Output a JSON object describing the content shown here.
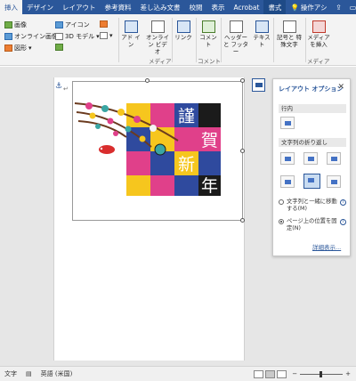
{
  "tabs": [
    {
      "label": "挿入",
      "active": true
    },
    {
      "label": "デザイン"
    },
    {
      "label": "レイアウト"
    },
    {
      "label": "参考資料"
    },
    {
      "label": "差し込み文書"
    },
    {
      "label": "校閲"
    },
    {
      "label": "表示"
    },
    {
      "label": "Acrobat"
    },
    {
      "label": "書式",
      "accent": true
    }
  ],
  "search": {
    "label": "操作アシ"
  },
  "ribbon": {
    "image": "画像",
    "online_image": "オンライン画像",
    "shapes": "図形",
    "icons": "アイコン",
    "model3d": "3D モデル",
    "addins": "アド イン",
    "online_video": "オンライン ビデオ",
    "link": "リンク",
    "comment": "コメント",
    "header_footer": "ヘッダーと フッター",
    "text": "テキスト",
    "symbols": "記号と 特殊文字",
    "media_insert": "メディア を挿入",
    "group_media": "メディア",
    "group_comment": "コメント",
    "group_media2": "メディア"
  },
  "card": {
    "chars": [
      "謹",
      "賀",
      "新",
      "年"
    ],
    "colors": {
      "pink": "#e0408a",
      "blue": "#2f4a9e",
      "yellow": "#f6c61e",
      "black": "#1b1b1b",
      "teal": "#3aa6a3"
    }
  },
  "pane": {
    "title": "レイアウト オプション",
    "section_inline": "行内",
    "section_wrap": "文字列の折り返し",
    "option_move": "文字列と一緒に移動する(M)",
    "option_fix": "ページ上の位置を固定(N)",
    "details_link": "詳細表示..."
  },
  "status": {
    "words": "文字",
    "language": "英語 (米国)"
  },
  "colors": {
    "accent": "#2b579a",
    "ribbon_bg": "#f3f3f3",
    "workspace_bg": "#e6e6e6"
  }
}
